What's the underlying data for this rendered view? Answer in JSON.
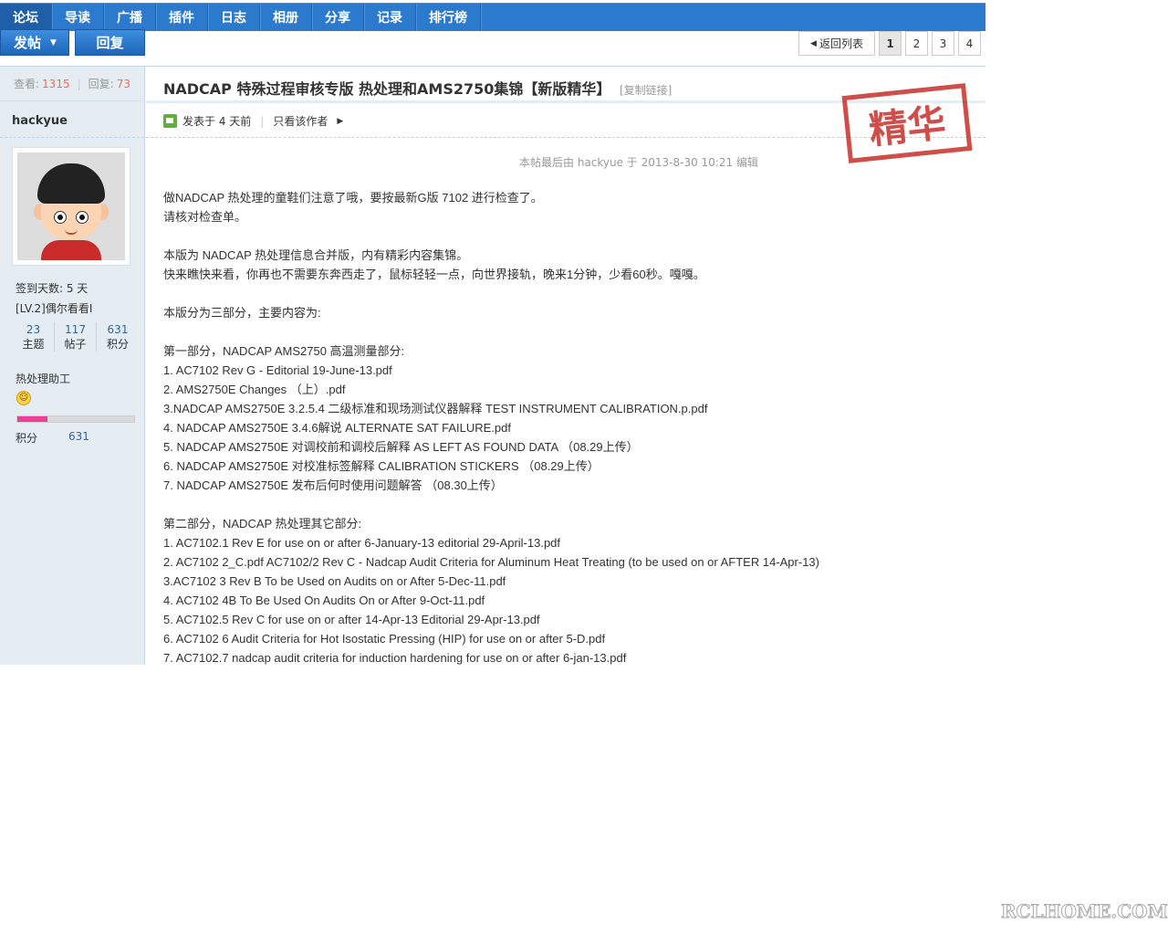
{
  "nav": [
    "论坛",
    "导读",
    "广播",
    "插件",
    "日志",
    "相册",
    "分享",
    "记录",
    "排行榜"
  ],
  "toolbar": {
    "post": "发帖",
    "reply": "回复"
  },
  "pager": {
    "back": "返回列表",
    "pages": [
      "1",
      "2",
      "3",
      "4"
    ],
    "current": "1"
  },
  "stats": {
    "views_label": "查看:",
    "views": "1315",
    "replies_label": "回复:",
    "replies": "73"
  },
  "author": {
    "name": "hackyue",
    "signin": "签到天数: 5 天",
    "level": "[LV.2]偶尔看看I",
    "counts": [
      {
        "value": "23",
        "label": "主题"
      },
      {
        "value": "117",
        "label": "帖子"
      },
      {
        "value": "631",
        "label": "积分"
      }
    ],
    "rank": "热处理助工",
    "progress": 0.26,
    "score_label": "积分",
    "score": "631"
  },
  "post": {
    "title": "NADCAP 特殊过程审核专版 热处理和AMS2750集锦【新版精华】",
    "copy_link": "[复制链接]",
    "posted": "发表于  4 天前",
    "only_author": "只看该作者",
    "stamp": "精华",
    "edit_note": "本帖最后由  hackyue  于  2013-8-30 10:21 编辑",
    "lines": [
      "做NADCAP 热处理的童鞋们注意了哦，要按最新G版  7102 进行检查了。",
      "请核对检查单。",
      "",
      "本版为  NADCAP 热处理信息合并版，内有精彩内容集锦。",
      "快来瞧快来看，你再也不需要东奔西走了，鼠标轻轻一点，向世界接轨，晚来1分钟，少看60秒。嘎嘎。",
      "",
      "本版分为三部分，主要内容为:",
      "",
      "第一部分，NADCAP AMS2750 高温测量部分:",
      "1. AC7102 Rev G - Editorial 19-June-13.pdf",
      "2. AMS2750E Changes （上）.pdf",
      "3.NADCAP AMS2750E 3.2.5.4 二级标准和现场测试仪器解释  TEST INSTRUMENT CALIBRATION.p.pdf",
      "4. NADCAP AMS2750E 3.4.6解说  ALTERNATE SAT FAILURE.pdf",
      "5. NADCAP AMS2750E 对调校前和调校后解释  AS LEFT AS FOUND DATA （08.29上传）",
      "6. NADCAP AMS2750E 对校准标签解释  CALIBRATION STICKERS   （08.29上传）",
      "7. NADCAP AMS2750E 发布后何时使用问题解答  （08.30上传）",
      "",
      "第二部分，NADCAP 热处理其它部分:",
      "1. AC7102.1 Rev E for use on or after 6-January-13 editorial 29-April-13.pdf",
      "2. AC7102 2_C.pdf AC7102/2 Rev C - Nadcap Audit Criteria for Aluminum Heat Treating (to be used on or AFTER 14-Apr-13)",
      "3.AC7102 3 Rev B To be Used on Audits on or After 5-Dec-11.pdf",
      "4. AC7102 4B To Be Used On Audits On or After 9-Oct-11.pdf",
      "5. AC7102.5 Rev C for use on or after 14-Apr-13 Editorial 29-Apr-13.pdf",
      "6. AC7102 6 Audit Criteria for Hot Isostatic Pressing (HIP) for use on or after 5-D.pdf",
      "7. AC7102.7 nadcap audit criteria for induction hardening for use on or after 6-jan-13.pdf"
    ]
  },
  "watermark": "RCLHOME.COM",
  "colors": {
    "nav": "#2b7acd",
    "sidebar": "#e5edf2",
    "stamp": "#c8302a",
    "accent_num": "#f26c4f"
  }
}
